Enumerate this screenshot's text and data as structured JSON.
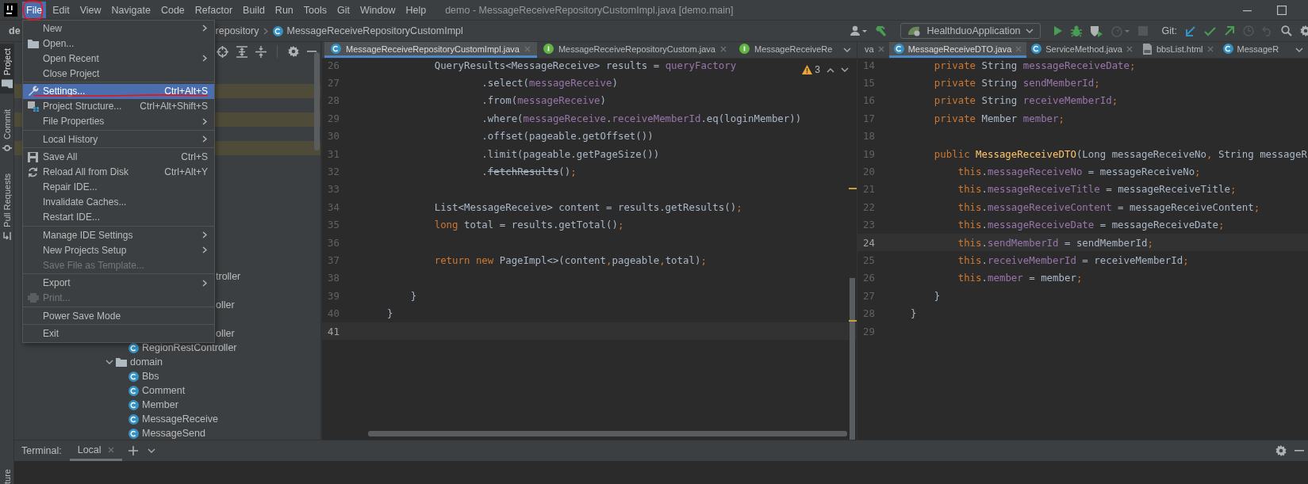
{
  "menubar": {
    "menus": [
      {
        "label": "File",
        "selected": true
      },
      {
        "label": "Edit",
        "selected": false
      },
      {
        "label": "View",
        "selected": false
      },
      {
        "label": "Navigate",
        "selected": false
      },
      {
        "label": "Code",
        "selected": false
      },
      {
        "label": "Refactor",
        "selected": false
      },
      {
        "label": "Build",
        "selected": false
      },
      {
        "label": "Run",
        "selected": false
      },
      {
        "label": "Tools",
        "selected": false
      },
      {
        "label": "Git",
        "selected": false
      },
      {
        "label": "Window",
        "selected": false
      },
      {
        "label": "Help",
        "selected": false
      }
    ],
    "title": "demo - MessageReceiveRepositoryCustomImpl.java [demo.main]"
  },
  "navbar": {
    "breadcrumbs": [
      {
        "label": "de",
        "kind": "plain"
      },
      {
        "label": "repository",
        "kind": "plain"
      },
      {
        "label": "MessageReceiveRepositoryCustomImpl",
        "kind": "class"
      }
    ],
    "actions": [
      {
        "kind": "user",
        "disabled": false
      },
      {
        "kind": "build",
        "disabled": false
      },
      {
        "kind": "config",
        "label": "HealthduoApplication"
      },
      {
        "kind": "run",
        "disabled": false
      },
      {
        "kind": "debug",
        "disabled": false
      },
      {
        "kind": "coverage",
        "disabled": false
      },
      {
        "kind": "profile",
        "disabled": true
      },
      {
        "kind": "stop",
        "disabled": true
      },
      {
        "kind": "label",
        "label": "Git:"
      },
      {
        "kind": "update",
        "disabled": false
      },
      {
        "kind": "commit",
        "disabled": false
      },
      {
        "kind": "push",
        "disabled": false
      },
      {
        "kind": "history",
        "disabled": true
      },
      {
        "kind": "rollback",
        "disabled": true
      },
      {
        "kind": "search",
        "disabled": false
      },
      {
        "kind": "settings",
        "disabled": false
      }
    ]
  },
  "stripe": {
    "tabs": [
      {
        "label": "Project",
        "selected": true
      },
      {
        "label": "Commit",
        "selected": false
      },
      {
        "label": "Pull Requests",
        "selected": false
      }
    ],
    "bottom_tab": "ture"
  },
  "project": {
    "items": [
      {
        "kind": "covered",
        "highlighted": false
      },
      {
        "kind": "covered",
        "highlighted": true
      },
      {
        "kind": "covered",
        "highlighted": false
      },
      {
        "kind": "covered",
        "highlighted": true
      },
      {
        "kind": "covered",
        "highlighted": false
      },
      {
        "kind": "covered",
        "highlighted": true
      },
      {
        "kind": "covered",
        "highlighted": false
      },
      {
        "kind": "covered",
        "highlighted": false
      },
      {
        "kind": "covered",
        "highlighted": false
      },
      {
        "kind": "covered",
        "highlighted": false
      },
      {
        "kind": "covered",
        "highlighted": false
      },
      {
        "kind": "covered",
        "highlighted": false
      },
      {
        "kind": "covered",
        "highlighted": false
      },
      {
        "kind": "covered",
        "highlighted": false,
        "children": [
          {
            "kind": "partial",
            "label": "troller",
            "highlighted": false
          },
          {
            "kind": "covered",
            "highlighted": false
          },
          {
            "kind": "partial",
            "label": "oller",
            "highlighted": false
          },
          {
            "kind": "covered",
            "highlighted": false
          },
          {
            "kind": "partial",
            "label": "oller",
            "highlighted": false
          },
          {
            "kind": "class",
            "label": "RegionRestController",
            "highlighted": false
          }
        ]
      },
      {
        "kind": "package",
        "label": "domain",
        "expanded": true,
        "highlighted": false,
        "children": [
          {
            "kind": "class",
            "label": "Bbs",
            "highlighted": false
          },
          {
            "kind": "class",
            "label": "Comment",
            "highlighted": false
          },
          {
            "kind": "class",
            "label": "Member",
            "highlighted": false
          },
          {
            "kind": "class",
            "label": "MessageReceive",
            "highlighted": false
          },
          {
            "kind": "class",
            "label": "MessageSend",
            "highlighted": false
          }
        ]
      }
    ]
  },
  "editors": [
    {
      "tabs": [
        {
          "label": "MessageReceiveRepositoryCustomImpl.java",
          "kind": "class",
          "selected": true,
          "closable": true
        },
        {
          "label": "MessageReceiveRepositoryCustom.java",
          "kind": "interface",
          "selected": false,
          "closable": true
        },
        {
          "label": "MessageReceiveRe",
          "kind": "interface",
          "selected": false,
          "closable": false
        }
      ],
      "warnings": {
        "count": "3"
      },
      "lines": [
        {
          "number": "26",
          "current": false,
          "segments": [
            {
              "text": "        QueryResults<MessageReceive> results = ",
              "kind": "plain"
            },
            {
              "text": "queryFactory",
              "kind": "field"
            }
          ]
        },
        {
          "number": "27",
          "current": false,
          "segments": [
            {
              "text": "                .select(",
              "kind": "plain"
            },
            {
              "text": "messageReceive",
              "kind": "field"
            },
            {
              "text": ")",
              "kind": "plain"
            }
          ]
        },
        {
          "number": "28",
          "current": false,
          "segments": [
            {
              "text": "                .from(",
              "kind": "plain"
            },
            {
              "text": "messageReceive",
              "kind": "field"
            },
            {
              "text": ")",
              "kind": "plain"
            }
          ]
        },
        {
          "number": "29",
          "current": false,
          "segments": [
            {
              "text": "                .where(",
              "kind": "plain"
            },
            {
              "text": "messageReceive",
              "kind": "field"
            },
            {
              "text": ".",
              "kind": "plain"
            },
            {
              "text": "receiveMemberId",
              "kind": "field"
            },
            {
              "text": ".eq(loginMember))",
              "kind": "plain"
            }
          ]
        },
        {
          "number": "30",
          "current": false,
          "segments": [
            {
              "text": "                .offset(pageable.getOffset())",
              "kind": "plain"
            }
          ]
        },
        {
          "number": "31",
          "current": false,
          "segments": [
            {
              "text": "                .limit(pageable.getPageSize())",
              "kind": "plain"
            }
          ]
        },
        {
          "number": "32",
          "current": false,
          "segments": [
            {
              "text": "                .",
              "kind": "plain"
            },
            {
              "text": "fetchResults",
              "kind": "deprecated"
            },
            {
              "text": "()",
              "kind": "plain"
            },
            {
              "text": ";",
              "kind": "keyword"
            }
          ]
        },
        {
          "number": "33",
          "current": false
        },
        {
          "number": "34",
          "current": false,
          "segments": [
            {
              "text": "        List<MessageReceive> content = results.getResults()",
              "kind": "plain"
            },
            {
              "text": ";",
              "kind": "keyword"
            }
          ]
        },
        {
          "number": "35",
          "current": false,
          "segments": [
            {
              "text": "        long",
              "kind": "keyword"
            },
            {
              "text": " total = results.getTotal()",
              "kind": "plain"
            },
            {
              "text": ";",
              "kind": "keyword"
            }
          ]
        },
        {
          "number": "36",
          "current": false
        },
        {
          "number": "37",
          "current": false,
          "segments": [
            {
              "text": "        return new",
              "kind": "keyword"
            },
            {
              "text": " PageImpl<>(content",
              "kind": "plain"
            },
            {
              "text": ",",
              "kind": "keyword"
            },
            {
              "text": "pageable",
              "kind": "plain"
            },
            {
              "text": ",",
              "kind": "keyword"
            },
            {
              "text": "total)",
              "kind": "plain"
            },
            {
              "text": ";",
              "kind": "keyword"
            }
          ]
        },
        {
          "number": "38",
          "current": false
        },
        {
          "number": "39",
          "current": false,
          "segments": [
            {
              "text": "    }",
              "kind": "plain"
            }
          ]
        },
        {
          "number": "40",
          "current": false,
          "segments": [
            {
              "text": "}",
              "kind": "plain"
            }
          ]
        },
        {
          "number": "41",
          "current": true
        }
      ]
    },
    {
      "tabs": [
        {
          "label": "va",
          "kind": "none",
          "selected": false,
          "closable": true
        },
        {
          "label": "MessageReceiveDTO.java",
          "kind": "class",
          "selected": true,
          "closable": true
        },
        {
          "label": "ServiceMethod.java",
          "kind": "class",
          "selected": false,
          "closable": true
        },
        {
          "label": "bbsList.html",
          "kind": "html",
          "selected": false,
          "closable": true
        },
        {
          "label": "MessageR",
          "kind": "class",
          "selected": false,
          "closable": false
        }
      ],
      "lines": [
        {
          "number": "14",
          "current": false,
          "segments": [
            {
              "text": "    private",
              "kind": "keyword"
            },
            {
              "text": " String ",
              "kind": "plain"
            },
            {
              "text": "messageReceiveDate",
              "kind": "field"
            },
            {
              "text": ";",
              "kind": "keyword"
            }
          ]
        },
        {
          "number": "15",
          "current": false,
          "segments": [
            {
              "text": "    private",
              "kind": "keyword"
            },
            {
              "text": " String ",
              "kind": "plain"
            },
            {
              "text": "sendMemberId",
              "kind": "field"
            },
            {
              "text": ";",
              "kind": "keyword"
            }
          ]
        },
        {
          "number": "16",
          "current": false,
          "segments": [
            {
              "text": "    private",
              "kind": "keyword"
            },
            {
              "text": " String ",
              "kind": "plain"
            },
            {
              "text": "receiveMemberId",
              "kind": "field"
            },
            {
              "text": ";",
              "kind": "keyword"
            }
          ]
        },
        {
          "number": "17",
          "current": false,
          "segments": [
            {
              "text": "    private",
              "kind": "keyword"
            },
            {
              "text": " Member ",
              "kind": "plain"
            },
            {
              "text": "member",
              "kind": "field"
            },
            {
              "text": ";",
              "kind": "keyword"
            }
          ]
        },
        {
          "number": "18",
          "current": false
        },
        {
          "number": "19",
          "current": false,
          "segments": [
            {
              "text": "    public ",
              "kind": "keyword"
            },
            {
              "text": "MessageReceiveDTO",
              "kind": "declaration"
            },
            {
              "text": "(Long messageReceiveNo",
              "kind": "plain"
            },
            {
              "text": ",",
              "kind": "keyword"
            },
            {
              "text": " String messageR",
              "kind": "plain"
            }
          ]
        },
        {
          "number": "20",
          "current": false,
          "segments": [
            {
              "text": "        this",
              "kind": "keyword"
            },
            {
              "text": ".",
              "kind": "plain"
            },
            {
              "text": "messageReceiveNo",
              "kind": "field"
            },
            {
              "text": " = messageReceiveNo",
              "kind": "plain"
            },
            {
              "text": ";",
              "kind": "keyword"
            }
          ]
        },
        {
          "number": "21",
          "current": false,
          "segments": [
            {
              "text": "        this",
              "kind": "keyword"
            },
            {
              "text": ".",
              "kind": "plain"
            },
            {
              "text": "messageReceiveTitle",
              "kind": "field"
            },
            {
              "text": " = messageReceiveTitle",
              "kind": "plain"
            },
            {
              "text": ";",
              "kind": "keyword"
            }
          ]
        },
        {
          "number": "22",
          "current": false,
          "segments": [
            {
              "text": "        this",
              "kind": "keyword"
            },
            {
              "text": ".",
              "kind": "plain"
            },
            {
              "text": "messageReceiveContent",
              "kind": "field"
            },
            {
              "text": " = messageReceiveContent",
              "kind": "plain"
            },
            {
              "text": ";",
              "kind": "keyword"
            }
          ]
        },
        {
          "number": "23",
          "current": false,
          "segments": [
            {
              "text": "        this",
              "kind": "keyword"
            },
            {
              "text": ".",
              "kind": "plain"
            },
            {
              "text": "messageReceiveDate",
              "kind": "field"
            },
            {
              "text": " = messageReceiveDate",
              "kind": "plain"
            },
            {
              "text": ";",
              "kind": "keyword"
            }
          ]
        },
        {
          "number": "24",
          "current": true,
          "segments": [
            {
              "text": "        this",
              "kind": "keyword"
            },
            {
              "text": ".",
              "kind": "plain"
            },
            {
              "text": "sendMemberId",
              "kind": "field"
            },
            {
              "text": " = sendMemberId",
              "kind": "plain"
            },
            {
              "text": ";",
              "kind": "keyword"
            }
          ]
        },
        {
          "number": "25",
          "current": false,
          "segments": [
            {
              "text": "        this",
              "kind": "keyword"
            },
            {
              "text": ".",
              "kind": "plain"
            },
            {
              "text": "receiveMemberId",
              "kind": "field"
            },
            {
              "text": " = receiveMemberId",
              "kind": "plain"
            },
            {
              "text": ";",
              "kind": "keyword"
            }
          ]
        },
        {
          "number": "26",
          "current": false,
          "segments": [
            {
              "text": "        this",
              "kind": "keyword"
            },
            {
              "text": ".",
              "kind": "plain"
            },
            {
              "text": "member",
              "kind": "field"
            },
            {
              "text": " = member",
              "kind": "plain"
            },
            {
              "text": ";",
              "kind": "keyword"
            }
          ]
        },
        {
          "number": "27",
          "current": false,
          "segments": [
            {
              "text": "    }",
              "kind": "plain"
            }
          ]
        },
        {
          "number": "28",
          "current": false,
          "segments": [
            {
              "text": "}",
              "kind": "plain"
            }
          ]
        },
        {
          "number": "29",
          "current": false
        }
      ]
    }
  ],
  "terminal": {
    "label": "Terminal:",
    "tabs": [
      {
        "label": "Local",
        "selected": true,
        "closable": true
      }
    ]
  },
  "file_menu": {
    "items": [
      {
        "kind": "item",
        "label": "New",
        "submenu": true,
        "selected": false,
        "disabled": false
      },
      {
        "kind": "item",
        "label": "Open...",
        "submenu": false,
        "selected": false,
        "disabled": false
      },
      {
        "kind": "item",
        "label": "Open Recent",
        "submenu": true,
        "selected": false,
        "disabled": false
      },
      {
        "kind": "item",
        "label": "Close Project",
        "submenu": false,
        "selected": false,
        "disabled": false
      },
      {
        "kind": "separator"
      },
      {
        "kind": "item",
        "label": "Settings...",
        "shortcut": "Ctrl+Alt+S",
        "submenu": false,
        "selected": true,
        "disabled": false
      },
      {
        "kind": "item",
        "label": "Project Structure...",
        "shortcut": "Ctrl+Alt+Shift+S",
        "submenu": false,
        "selected": false,
        "disabled": false
      },
      {
        "kind": "item",
        "label": "File Properties",
        "submenu": true,
        "selected": false,
        "disabled": false
      },
      {
        "kind": "separator"
      },
      {
        "kind": "item",
        "label": "Local History",
        "submenu": true,
        "selected": false,
        "disabled": false
      },
      {
        "kind": "separator"
      },
      {
        "kind": "item",
        "label": "Save All",
        "shortcut": "Ctrl+S",
        "submenu": false,
        "selected": false,
        "disabled": false
      },
      {
        "kind": "item",
        "label": "Reload All from Disk",
        "shortcut": "Ctrl+Alt+Y",
        "submenu": false,
        "selected": false,
        "disabled": false
      },
      {
        "kind": "item",
        "label": "Repair IDE...",
        "submenu": false,
        "selected": false,
        "disabled": false
      },
      {
        "kind": "item",
        "label": "Invalidate Caches...",
        "submenu": false,
        "selected": false,
        "disabled": false
      },
      {
        "kind": "item",
        "label": "Restart IDE...",
        "submenu": false,
        "selected": false,
        "disabled": false
      },
      {
        "kind": "separator"
      },
      {
        "kind": "item",
        "label": "Manage IDE Settings",
        "submenu": true,
        "selected": false,
        "disabled": false
      },
      {
        "kind": "item",
        "label": "New Projects Setup",
        "submenu": true,
        "selected": false,
        "disabled": false
      },
      {
        "kind": "item",
        "label": "Save File as Template...",
        "submenu": false,
        "selected": false,
        "disabled": true
      },
      {
        "kind": "separator"
      },
      {
        "kind": "item",
        "label": "Export",
        "submenu": true,
        "selected": false,
        "disabled": false
      },
      {
        "kind": "item",
        "label": "Print...",
        "submenu": false,
        "selected": false,
        "disabled": true
      },
      {
        "kind": "separator"
      },
      {
        "kind": "item",
        "label": "Power Save Mode",
        "submenu": false,
        "selected": false,
        "disabled": false
      },
      {
        "kind": "separator"
      },
      {
        "kind": "item",
        "label": "Exit",
        "submenu": false,
        "selected": false,
        "disabled": false
      }
    ]
  }
}
